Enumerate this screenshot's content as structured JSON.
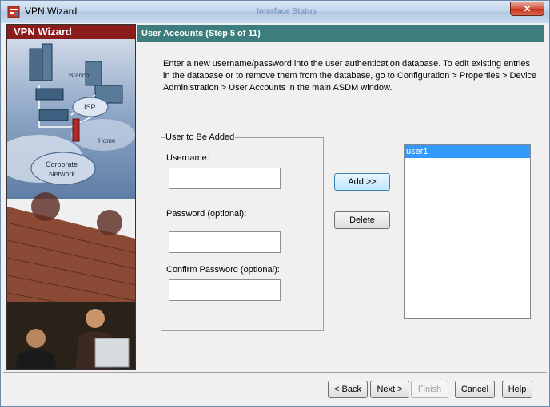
{
  "window": {
    "title": "VPN Wizard",
    "ghost_title": "Interface Status",
    "close_label": "✕"
  },
  "left_panel": {
    "header": "VPN Wizard",
    "art_labels": {
      "branch": "Branch",
      "isp": "ISP",
      "home": "Home",
      "corporate": "Corporate",
      "network": "Network"
    }
  },
  "step": {
    "header": "User Accounts  (Step 5 of 11)",
    "description": "Enter a new username/password into the user authentication database. To edit existing entries in the database or to remove them from the database, go to Configuration > Properties > Device Administration > User Accounts in the main ASDM window."
  },
  "form": {
    "group_title": "User to Be Added",
    "username_label": "Username:",
    "username_value": "",
    "password_label": "Password (optional):",
    "password_value": "",
    "confirm_label": "Confirm Password (optional):",
    "confirm_value": ""
  },
  "actions": {
    "add": "Add >>",
    "delete": "Delete"
  },
  "users": [
    "user1"
  ],
  "footer": {
    "back": "< Back",
    "next": "Next >",
    "finish": "Finish",
    "cancel": "Cancel",
    "help": "Help"
  },
  "colors": {
    "header_teal": "#3d7d7d",
    "brand_red": "#8b1c1c",
    "selection": "#3399ff"
  }
}
